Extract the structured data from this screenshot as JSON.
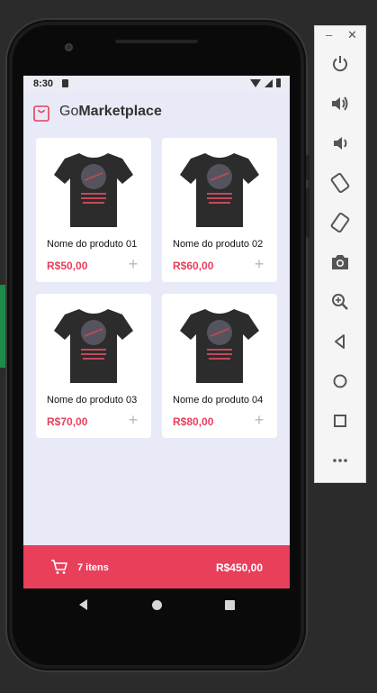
{
  "status_bar": {
    "time": "8:30"
  },
  "header": {
    "brand_prefix": "Go",
    "brand_suffix": "Marketplace"
  },
  "products": [
    {
      "title": "Nome do produto 01",
      "price": "R$50,00"
    },
    {
      "title": "Nome do produto 02",
      "price": "R$60,00"
    },
    {
      "title": "Nome do produto 03",
      "price": "R$70,00"
    },
    {
      "title": "Nome do produto 04",
      "price": "R$80,00"
    }
  ],
  "add_label": "+",
  "footer": {
    "items": "7 itens",
    "total": "R$450,00"
  },
  "emulator": {
    "minimize": "–",
    "close": "✕"
  },
  "colors": {
    "accent": "#e83f5b",
    "background": "#e9eaf7",
    "card": "#ffffff"
  },
  "icons": [
    "shopping-bag-icon",
    "cart-icon",
    "plus-icon",
    "power-icon",
    "volume-up-icon",
    "volume-down-icon",
    "rotate-left-icon",
    "rotate-right-icon",
    "camera-icon",
    "zoom-icon",
    "back-icon",
    "home-icon",
    "overview-icon",
    "more-icon"
  ]
}
